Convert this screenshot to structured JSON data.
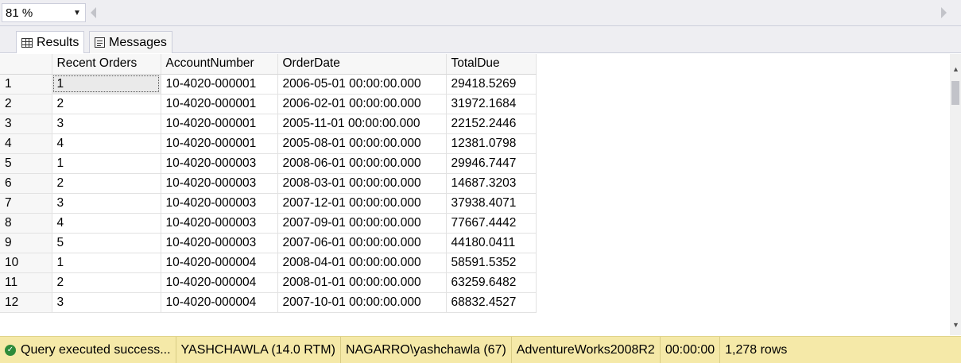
{
  "zoom": {
    "value": "81 %"
  },
  "tabs": {
    "results_label": "Results",
    "messages_label": "Messages"
  },
  "grid": {
    "columns": [
      "Recent Orders",
      "AccountNumber",
      "OrderDate",
      "TotalDue"
    ],
    "rows": [
      {
        "n": "1",
        "recent": "1",
        "account": "10-4020-000001",
        "date": "2006-05-01 00:00:00.000",
        "total": "29418.5269"
      },
      {
        "n": "2",
        "recent": "2",
        "account": "10-4020-000001",
        "date": "2006-02-01 00:00:00.000",
        "total": "31972.1684"
      },
      {
        "n": "3",
        "recent": "3",
        "account": "10-4020-000001",
        "date": "2005-11-01 00:00:00.000",
        "total": "22152.2446"
      },
      {
        "n": "4",
        "recent": "4",
        "account": "10-4020-000001",
        "date": "2005-08-01 00:00:00.000",
        "total": "12381.0798"
      },
      {
        "n": "5",
        "recent": "1",
        "account": "10-4020-000003",
        "date": "2008-06-01 00:00:00.000",
        "total": "29946.7447"
      },
      {
        "n": "6",
        "recent": "2",
        "account": "10-4020-000003",
        "date": "2008-03-01 00:00:00.000",
        "total": "14687.3203"
      },
      {
        "n": "7",
        "recent": "3",
        "account": "10-4020-000003",
        "date": "2007-12-01 00:00:00.000",
        "total": "37938.4071"
      },
      {
        "n": "8",
        "recent": "4",
        "account": "10-4020-000003",
        "date": "2007-09-01 00:00:00.000",
        "total": "77667.4442"
      },
      {
        "n": "9",
        "recent": "5",
        "account": "10-4020-000003",
        "date": "2007-06-01 00:00:00.000",
        "total": "44180.0411"
      },
      {
        "n": "10",
        "recent": "1",
        "account": "10-4020-000004",
        "date": "2008-04-01 00:00:00.000",
        "total": "58591.5352"
      },
      {
        "n": "11",
        "recent": "2",
        "account": "10-4020-000004",
        "date": "2008-01-01 00:00:00.000",
        "total": "63259.6482"
      },
      {
        "n": "12",
        "recent": "3",
        "account": "10-4020-000004",
        "date": "2007-10-01 00:00:00.000",
        "total": "68832.4527"
      }
    ]
  },
  "status": {
    "icon": "check-circle-icon",
    "message": "Query executed success...",
    "server": "YASHCHAWLA (14.0 RTM)",
    "user": "NAGARRO\\yashchawla (67)",
    "database": "AdventureWorks2008R2",
    "elapsed": "00:00:00",
    "rows": "1,278 rows",
    "background_color": "#f5e9a8"
  }
}
